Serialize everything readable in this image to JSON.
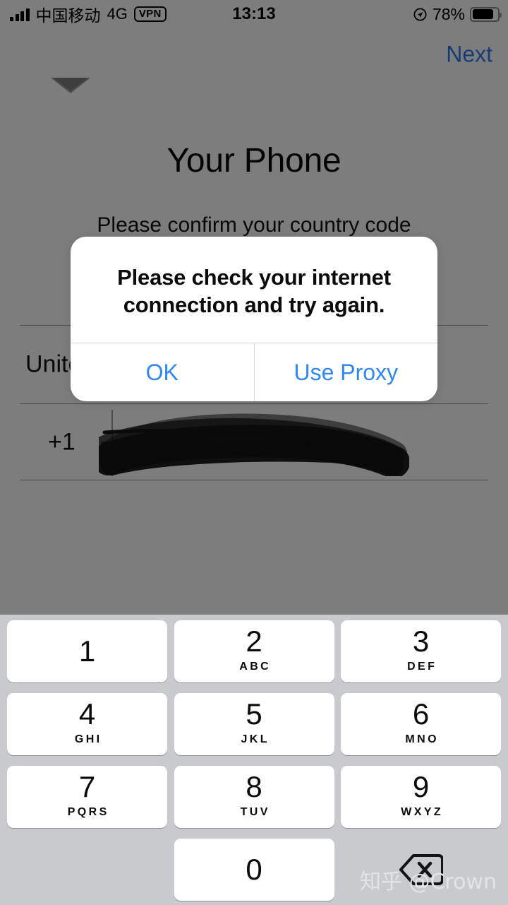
{
  "status_bar": {
    "carrier": "中国移动",
    "network": "4G",
    "vpn_label": "VPN",
    "time": "13:13",
    "battery_percent": "78%",
    "signal_icon": "signal-bars-icon",
    "location_icon": "location-arrow-icon",
    "battery_icon": "battery-icon"
  },
  "nav": {
    "next_label": "Next"
  },
  "form": {
    "title": "Your Phone",
    "subtitle": "Please confirm your country code",
    "country_name": "United States",
    "country_name_visible": "Unit",
    "phone_prefix": "+1",
    "phone_number": "",
    "phone_number_state": "redacted"
  },
  "alert": {
    "message": "Please check your internet connection and try again.",
    "buttons": [
      {
        "label": "OK",
        "name": "alert-button-ok"
      },
      {
        "label": "Use Proxy",
        "name": "alert-button-use-proxy"
      }
    ]
  },
  "keypad": {
    "rows": [
      [
        {
          "digit": "1",
          "letters": ""
        },
        {
          "digit": "2",
          "letters": "ABC"
        },
        {
          "digit": "3",
          "letters": "DEF"
        }
      ],
      [
        {
          "digit": "4",
          "letters": "GHI"
        },
        {
          "digit": "5",
          "letters": "JKL"
        },
        {
          "digit": "6",
          "letters": "MNO"
        }
      ],
      [
        {
          "digit": "7",
          "letters": "PQRS"
        },
        {
          "digit": "8",
          "letters": "TUV"
        },
        {
          "digit": "9",
          "letters": "WXYZ"
        }
      ],
      [
        {
          "digit": "",
          "letters": ""
        },
        {
          "digit": "0",
          "letters": ""
        },
        {
          "digit": "",
          "letters": "",
          "icon": "delete-backspace-icon"
        }
      ]
    ]
  },
  "watermark": {
    "text": "知乎 @Crown"
  },
  "colors": {
    "accent_blue": "#2f87f5",
    "dim_overlay": "#7d7e80",
    "keypad_background": "#c9cace",
    "key_white": "#ffffff",
    "separator": "#9a9b9d"
  }
}
